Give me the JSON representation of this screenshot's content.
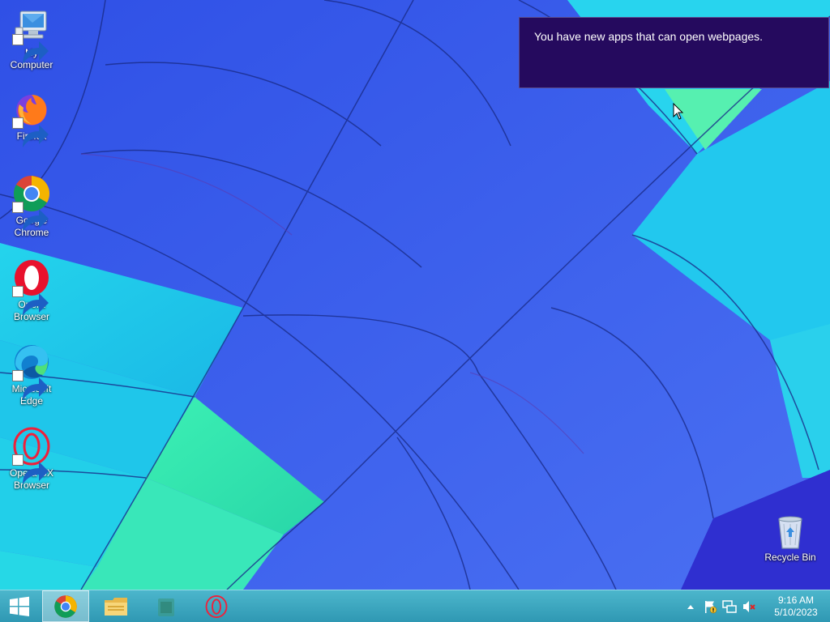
{
  "desktop_icons": [
    {
      "name": "my-computer",
      "label": "My Computer",
      "icon": "computer-icon"
    },
    {
      "name": "firefox",
      "label": "Firefox",
      "icon": "firefox-icon"
    },
    {
      "name": "google-chrome",
      "label": "Google Chrome",
      "icon": "chrome-icon"
    },
    {
      "name": "opera-browser",
      "label": "Opera Browser",
      "icon": "opera-icon"
    },
    {
      "name": "microsoft-edge",
      "label": "Microsoft Edge",
      "icon": "edge-icon"
    },
    {
      "name": "opera-gx-browser",
      "label": "Opera GX Browser",
      "icon": "opera-gx-icon"
    },
    {
      "name": "recycle-bin",
      "label": "Recycle Bin",
      "icon": "recycle-bin-icon"
    }
  ],
  "notification": {
    "message": "You have new apps that can open webpages.",
    "background": "#250a5e"
  },
  "taskbar": {
    "start_icon": "windows-logo-icon",
    "pinned": [
      {
        "name": "chrome",
        "icon": "chrome-icon",
        "active": true
      },
      {
        "name": "file-explorer",
        "icon": "folder-icon",
        "active": false
      },
      {
        "name": "app",
        "icon": "app-icon",
        "active": false
      },
      {
        "name": "opera-gx",
        "icon": "opera-gx-icon",
        "active": false
      }
    ],
    "tray_icons": [
      "show-hidden-icons-chevron",
      "action-center-flag-icon",
      "network-icon",
      "volume-muted-icon"
    ],
    "clock": {
      "time": "9:16 AM",
      "date": "5/10/2023"
    },
    "color": "#3aa6bf"
  }
}
